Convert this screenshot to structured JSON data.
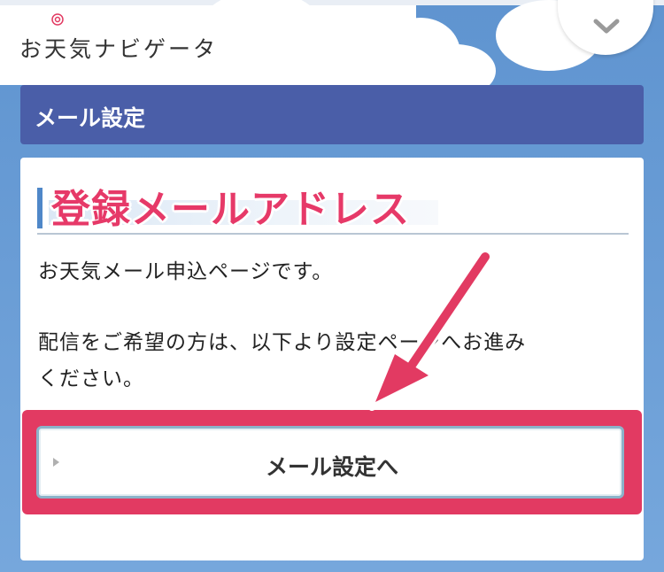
{
  "header": {
    "logo_text": "お天気ナビゲータ",
    "toggle_icon": "chevron-down-icon"
  },
  "titlebar": {
    "title": "メール設定"
  },
  "section": {
    "heading": "登録メールアドレス"
  },
  "content": {
    "line1": "お天気メール申込ページです。",
    "line2": "配信をご希望の方は、以下より設定ページへお進み",
    "line3": "ください。"
  },
  "button": {
    "label": "メール設定へ"
  },
  "colors": {
    "accent": "#e23a62",
    "titlebar": "#4a5ea8",
    "sky": "#6e9fd4"
  }
}
